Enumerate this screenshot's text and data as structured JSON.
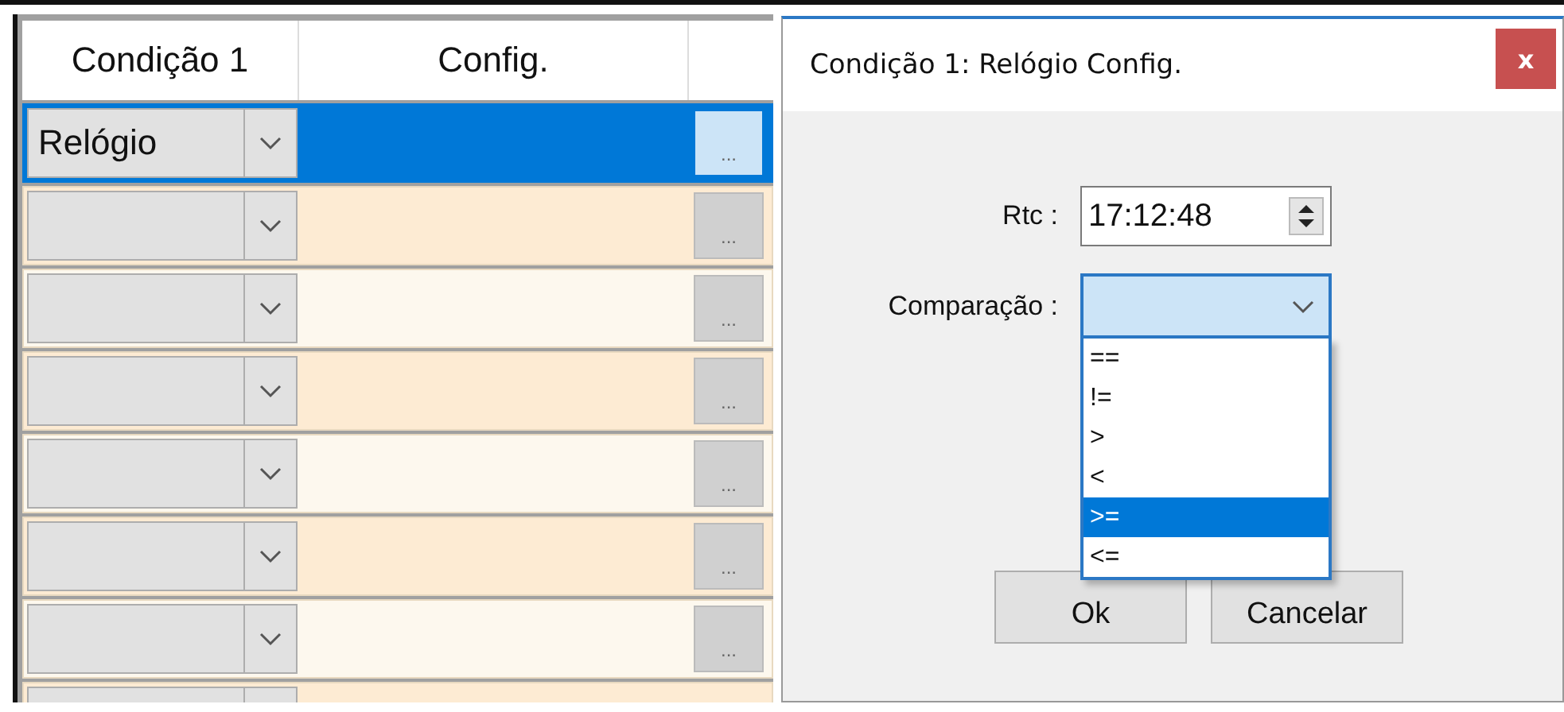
{
  "table": {
    "columns": [
      "Condição 1",
      "Config."
    ],
    "rows": [
      {
        "condition": "Relógio",
        "button": "...",
        "selected": true
      },
      {
        "button": "...",
        "selected": false
      },
      {
        "button": "...",
        "selected": false
      },
      {
        "button": "...",
        "selected": false
      },
      {
        "button": "...",
        "selected": false
      },
      {
        "button": "...",
        "selected": false
      },
      {
        "button": "...",
        "selected": false
      },
      {
        "selected": false
      }
    ]
  },
  "dialog": {
    "title": "Condição 1: Relógio Config.",
    "close": "x",
    "rtc": {
      "label": "Rtc :",
      "value": "17:12:48"
    },
    "comparison": {
      "label": "Comparação :",
      "expanded": true,
      "options": [
        {
          "label": "==",
          "selected": false
        },
        {
          "label": "!=",
          "selected": false
        },
        {
          "label": ">",
          "selected": false
        },
        {
          "label": "<",
          "selected": false
        },
        {
          "label": ">=",
          "selected": true
        },
        {
          "label": "<=",
          "selected": false
        }
      ]
    },
    "buttons": [
      "Ok",
      "Cancelar"
    ]
  }
}
